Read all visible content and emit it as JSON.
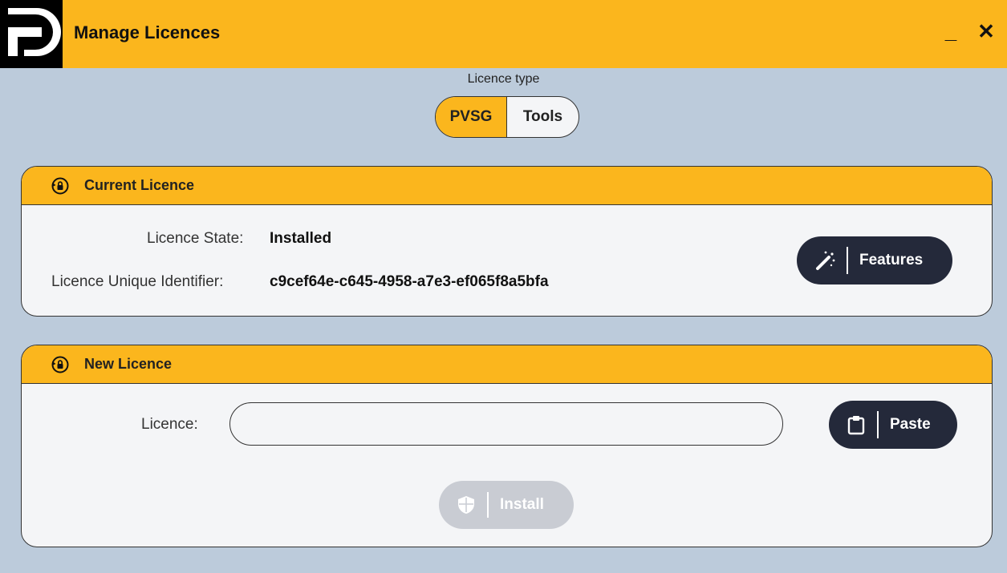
{
  "window": {
    "title": "Manage Licences",
    "minimize_label": "_",
    "close_label": "✕"
  },
  "licence_type": {
    "label": "Licence type",
    "options": [
      "PVSG",
      "Tools"
    ],
    "selected": "PVSG"
  },
  "current_licence": {
    "header": "Current Licence",
    "state_label": "Licence State:",
    "state_value": "Installed",
    "uid_label": "Licence Unique Identifier:",
    "uid_value": "c9cef64e-c645-4958-a7e3-ef065f8a5bfa",
    "features_button": "Features"
  },
  "new_licence": {
    "header": "New Licence",
    "licence_label": "Licence:",
    "licence_value": "",
    "paste_button": "Paste",
    "install_button": "Install"
  },
  "colors": {
    "accent": "#fbb61d",
    "background": "#bccbdb",
    "panel": "#f4f5f7",
    "dark_button": "#24293a",
    "disabled_button": "#c9ccd3"
  },
  "icons": {
    "logo": "app-logo-icon",
    "header": "lock-refresh-icon",
    "features": "magic-wand-icon",
    "paste": "clipboard-icon",
    "install": "shield-icon"
  }
}
